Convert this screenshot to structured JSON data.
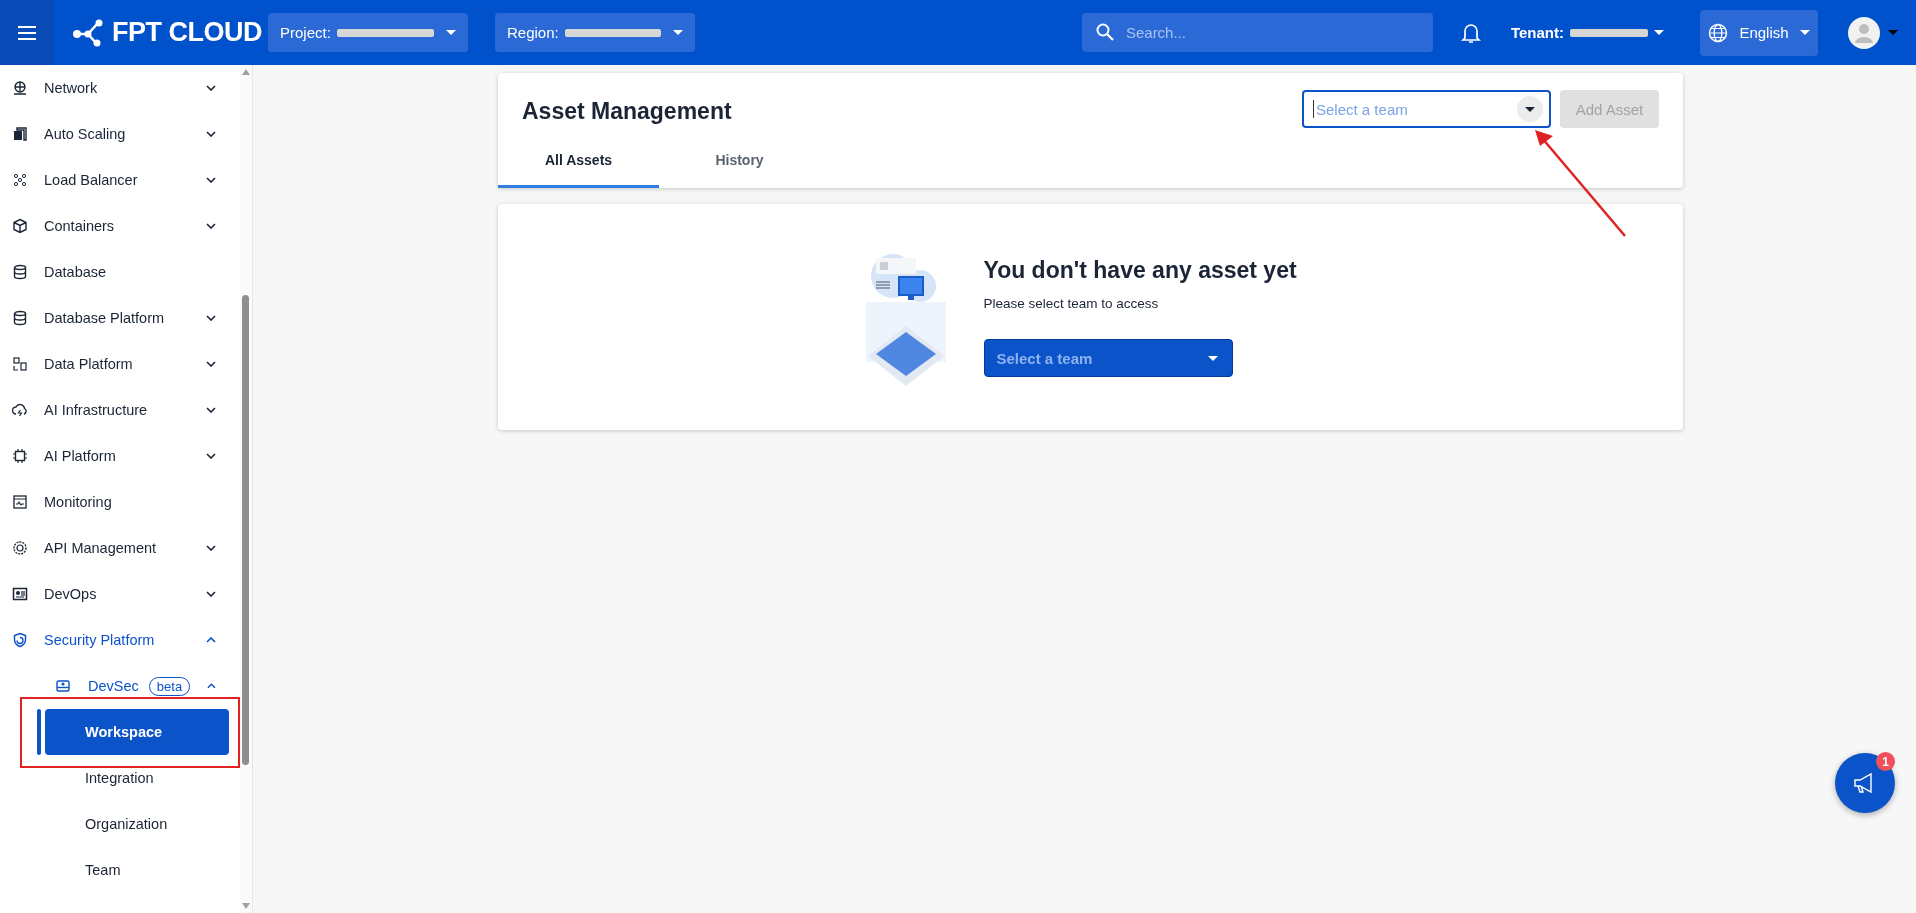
{
  "header": {
    "logo": "FPT CLOUD",
    "project": {
      "label": "Project:"
    },
    "region": {
      "label": "Region:"
    },
    "search": {
      "placeholder": "Search..."
    },
    "tenant": {
      "label": "Tenant:"
    },
    "language": "English"
  },
  "sidebar": {
    "items": [
      {
        "label": "Network",
        "expanded": false,
        "selected": false
      },
      {
        "label": "Auto Scaling",
        "expanded": false,
        "selected": false
      },
      {
        "label": "Load Balancer",
        "expanded": false,
        "selected": false
      },
      {
        "label": "Containers",
        "expanded": false,
        "selected": false
      },
      {
        "label": "Database",
        "selected": false
      },
      {
        "label": "Database Platform",
        "expanded": false,
        "selected": false
      },
      {
        "label": "Data Platform",
        "expanded": false,
        "selected": false
      },
      {
        "label": "AI Infrastructure",
        "expanded": false,
        "selected": false
      },
      {
        "label": "AI Platform",
        "expanded": false,
        "selected": false
      },
      {
        "label": "Monitoring",
        "selected": false
      },
      {
        "label": "API Management",
        "expanded": false,
        "selected": false
      },
      {
        "label": "DevOps",
        "expanded": false,
        "selected": false
      },
      {
        "label": "Security Platform",
        "expanded": true,
        "children": [
          {
            "label": "DevSec",
            "badge": "beta",
            "expanded": true,
            "children": [
              {
                "label": "Workspace",
                "selected": true
              },
              {
                "label": "Integration",
                "selected": false
              },
              {
                "label": "Organization",
                "selected": false
              },
              {
                "label": "Team",
                "selected": false
              }
            ]
          }
        ]
      }
    ]
  },
  "page": {
    "title": "Asset Management",
    "team_select": {
      "placeholder": "Select a team",
      "focused": true
    },
    "add_button": {
      "label": "Add Asset",
      "disabled": true
    },
    "tabs": [
      {
        "label": "All Assets",
        "selected": true
      },
      {
        "label": "History",
        "selected": false
      }
    ],
    "empty_state": {
      "title": "You don't have any asset yet",
      "subtitle": "Please select team to access",
      "select_button": "Select a team"
    }
  },
  "notification_fab": {
    "badge": "1"
  }
}
